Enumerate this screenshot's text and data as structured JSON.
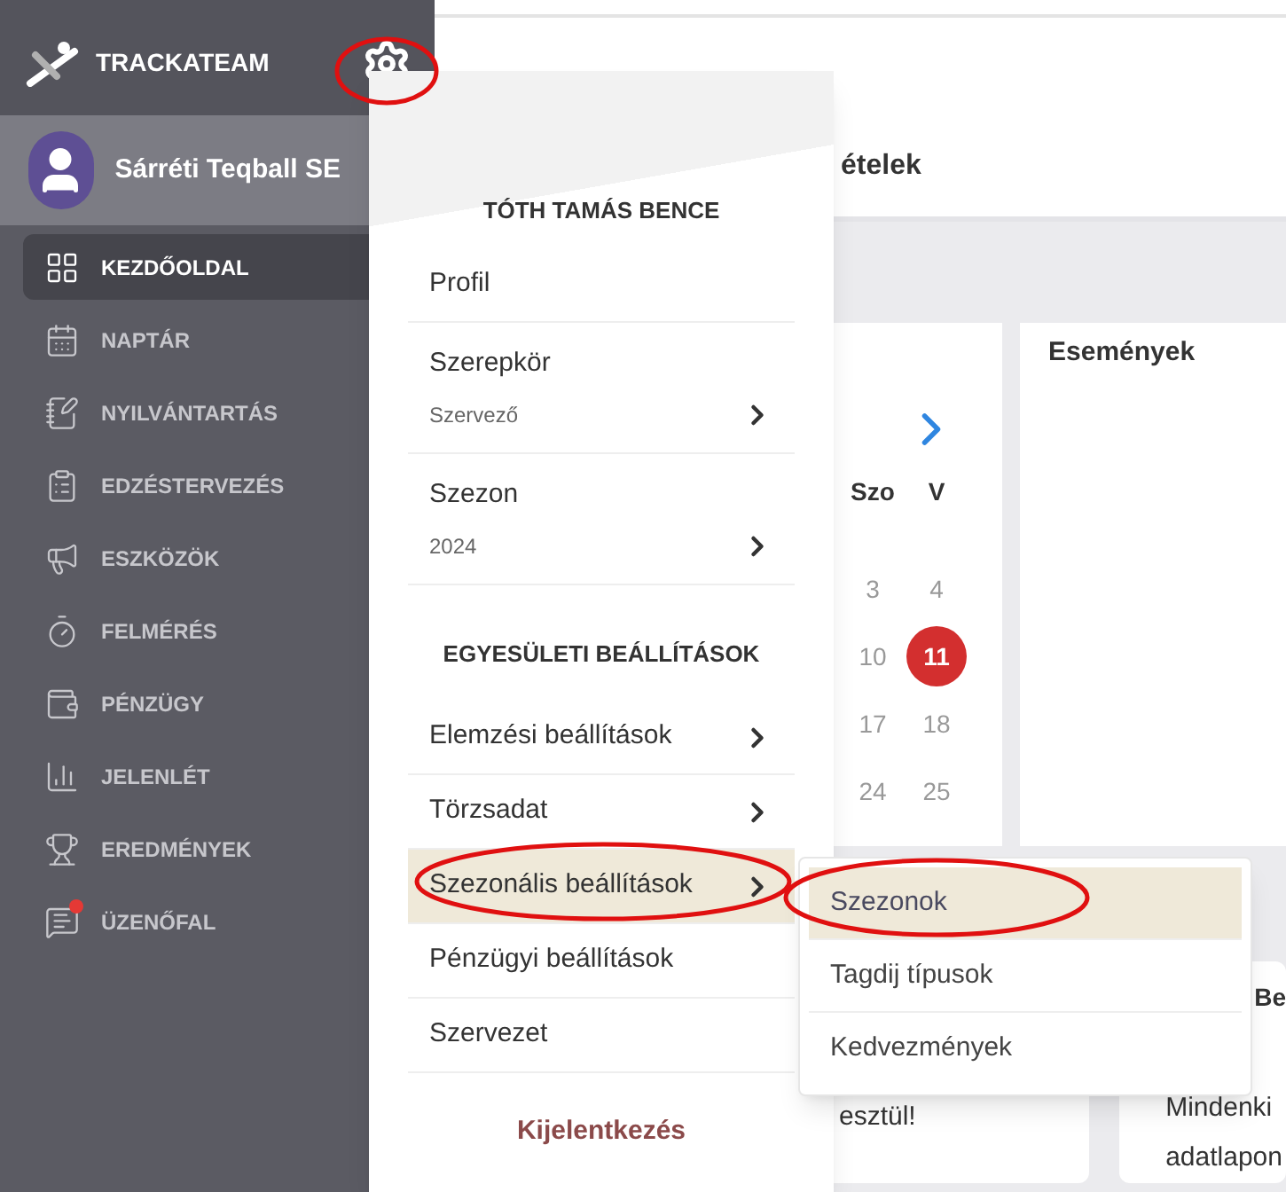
{
  "brand": {
    "name": "TRACKATEAM"
  },
  "team": {
    "name": "Sárréti Teqball SE"
  },
  "sidebar": {
    "items": [
      {
        "label": "KEZDŐOLDAL",
        "selected": true,
        "notification": false
      },
      {
        "label": "NAPTÁR",
        "selected": false,
        "notification": false
      },
      {
        "label": "NYILVÁNTARTÁS",
        "selected": false,
        "notification": false
      },
      {
        "label": "EDZÉSTERVEZÉS",
        "selected": false,
        "notification": false
      },
      {
        "label": "ESZKÖZÖK",
        "selected": false,
        "notification": false
      },
      {
        "label": "FELMÉRÉS",
        "selected": false,
        "notification": false
      },
      {
        "label": "PÉNZÜGY",
        "selected": false,
        "notification": false
      },
      {
        "label": "JELENLÉT",
        "selected": false,
        "notification": false
      },
      {
        "label": "EREDMÉNYEK",
        "selected": false,
        "notification": false
      },
      {
        "label": "ÜZENŐFAL",
        "selected": false,
        "notification": true
      }
    ]
  },
  "main": {
    "section_title": "ételek",
    "calendar": {
      "weekdays": [
        "Szo",
        "V"
      ],
      "weeks": [
        [
          {
            "day": "3",
            "selected": false
          },
          {
            "day": "4",
            "selected": false
          }
        ],
        [
          {
            "day": "10",
            "selected": false
          },
          {
            "day": "11",
            "selected": true
          }
        ],
        [
          {
            "day": "17",
            "selected": false
          },
          {
            "day": "18",
            "selected": false
          }
        ],
        [
          {
            "day": "24",
            "selected": false
          },
          {
            "day": "25",
            "selected": false
          }
        ]
      ]
    },
    "events_title": "Események",
    "cards": [
      {
        "lines": [
          "esztül!"
        ]
      },
      {
        "title": "Be",
        "lines": [
          "Mindenki",
          "adatlapon"
        ]
      }
    ]
  },
  "user_menu": {
    "user": "TÓTH TAMÁS BENCE",
    "items": [
      {
        "kind": "item",
        "label": "Profil",
        "submenu": false,
        "selected": false
      },
      {
        "kind": "item",
        "label": "Szerepkör",
        "value": "Szervező",
        "submenu": true,
        "selected": false
      },
      {
        "kind": "item",
        "label": "Szezon",
        "value": "2024",
        "submenu": true,
        "selected": false
      },
      {
        "kind": "header",
        "label": "EGYESÜLETI BEÁLLÍTÁSOK"
      },
      {
        "kind": "item",
        "label": "Elemzési beállítások",
        "submenu": true,
        "selected": false
      },
      {
        "kind": "item",
        "label": "Törzsadat",
        "submenu": true,
        "selected": false
      },
      {
        "kind": "item",
        "label": "Szezonális beállítások",
        "submenu": true,
        "selected": true
      },
      {
        "kind": "item",
        "label": "Pénzügyi beállítások",
        "submenu": false,
        "selected": false
      },
      {
        "kind": "item",
        "label": "Szervezet",
        "submenu": false,
        "selected": false
      }
    ],
    "logout": "Kijelentkezés"
  },
  "submenu": {
    "items": [
      {
        "label": "Szezonok",
        "selected": true
      },
      {
        "label": "Tagdij típusok",
        "selected": false
      },
      {
        "label": "Kedvezmények",
        "selected": false
      }
    ]
  }
}
